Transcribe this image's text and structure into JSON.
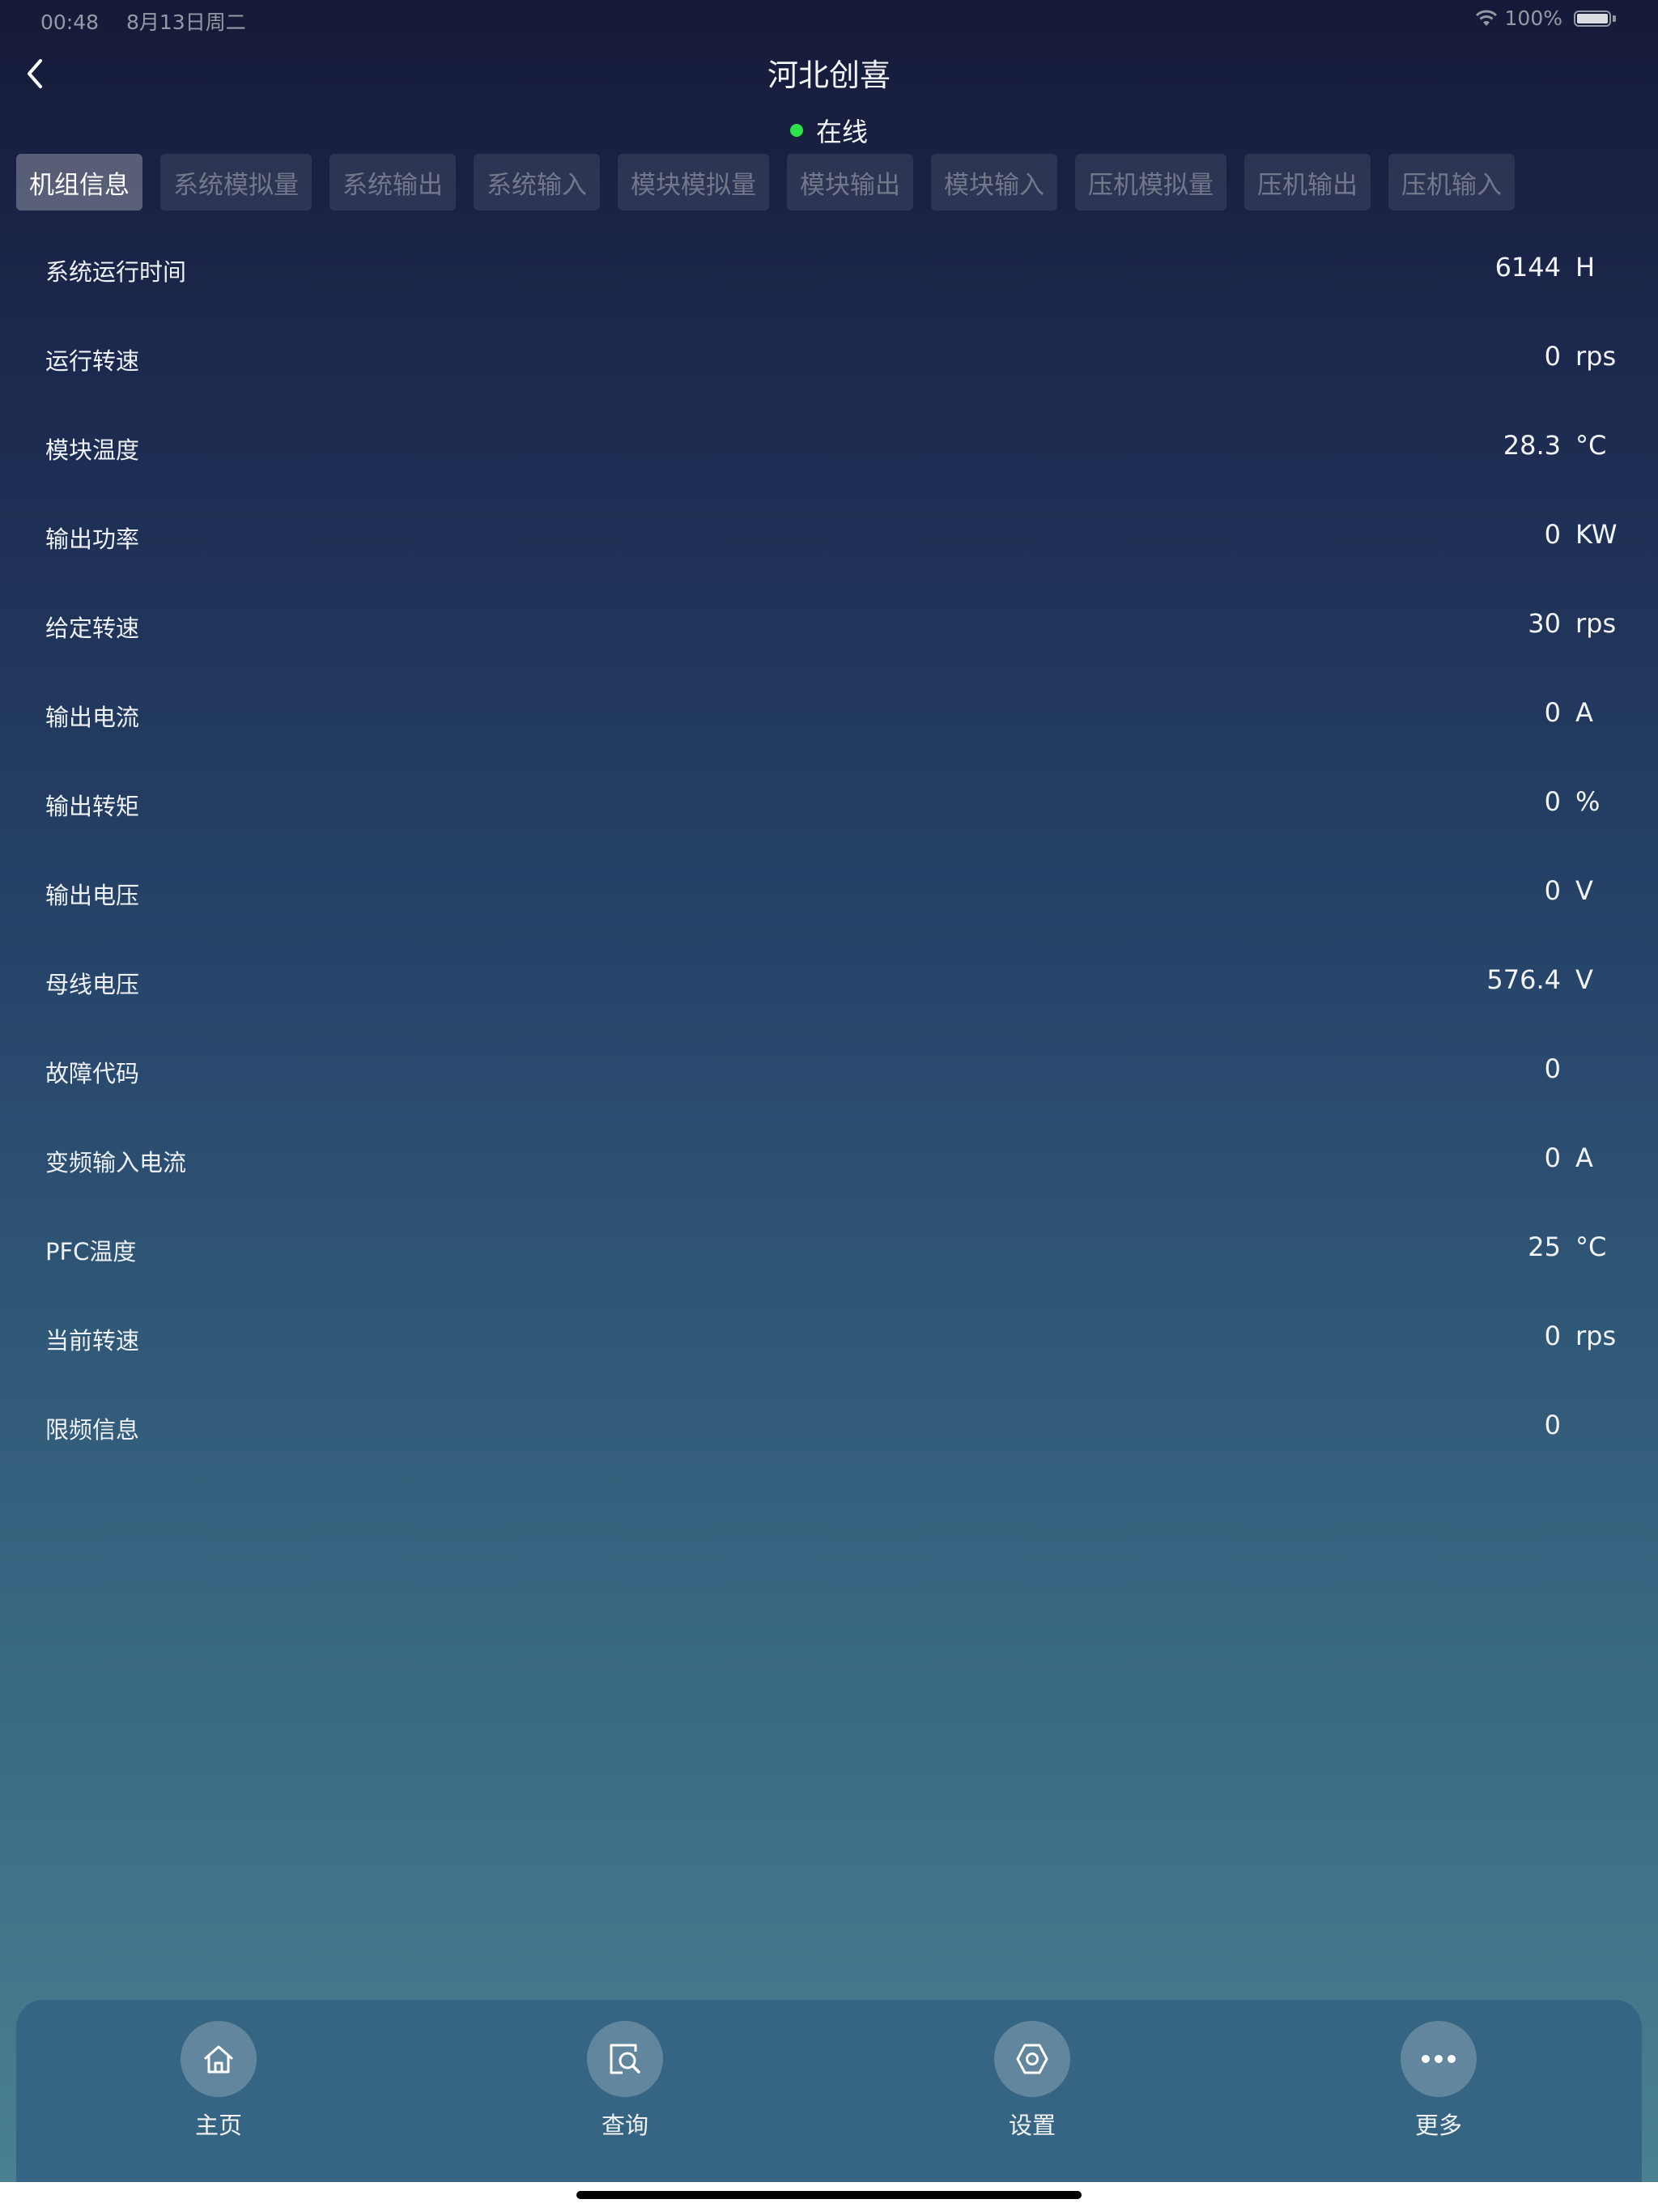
{
  "status_bar": {
    "time": "00:48",
    "date": "8月13日周二",
    "battery_percent": "100%",
    "icons": [
      "wifi-icon",
      "battery-icon"
    ]
  },
  "header": {
    "title": "河北创喜",
    "status": "在线",
    "status_color": "#2ee34a"
  },
  "tabs": [
    {
      "label": "机组信息",
      "active": true
    },
    {
      "label": "系统模拟量",
      "active": false
    },
    {
      "label": "系统输出",
      "active": false
    },
    {
      "label": "系统输入",
      "active": false
    },
    {
      "label": "模块模拟量",
      "active": false
    },
    {
      "label": "模块输出",
      "active": false
    },
    {
      "label": "模块输入",
      "active": false
    },
    {
      "label": "压机模拟量",
      "active": false
    },
    {
      "label": "压机输出",
      "active": false
    },
    {
      "label": "压机输入",
      "active": false
    }
  ],
  "rows": [
    {
      "label": "系统运行时间",
      "value": "6144",
      "unit": "H"
    },
    {
      "label": "运行转速",
      "value": "0",
      "unit": "rps"
    },
    {
      "label": "模块温度",
      "value": "28.3",
      "unit": "°C"
    },
    {
      "label": "输出功率",
      "value": "0",
      "unit": "KW"
    },
    {
      "label": "给定转速",
      "value": "30",
      "unit": "rps"
    },
    {
      "label": "输出电流",
      "value": "0",
      "unit": "A"
    },
    {
      "label": "输出转矩",
      "value": "0",
      "unit": "%"
    },
    {
      "label": "输出电压",
      "value": "0",
      "unit": "V"
    },
    {
      "label": "母线电压",
      "value": "576.4",
      "unit": "V"
    },
    {
      "label": "故障代码",
      "value": "0",
      "unit": ""
    },
    {
      "label": "变频输入电流",
      "value": "0",
      "unit": "A"
    },
    {
      "label": "PFC温度",
      "value": "25",
      "unit": "°C"
    },
    {
      "label": "当前转速",
      "value": "0",
      "unit": "rps"
    },
    {
      "label": "限频信息",
      "value": "0",
      "unit": ""
    }
  ],
  "bottom_nav": [
    {
      "label": "主页",
      "icon": "home-icon"
    },
    {
      "label": "查询",
      "icon": "query-icon"
    },
    {
      "label": "设置",
      "icon": "settings-icon"
    },
    {
      "label": "更多",
      "icon": "more-icon"
    }
  ]
}
